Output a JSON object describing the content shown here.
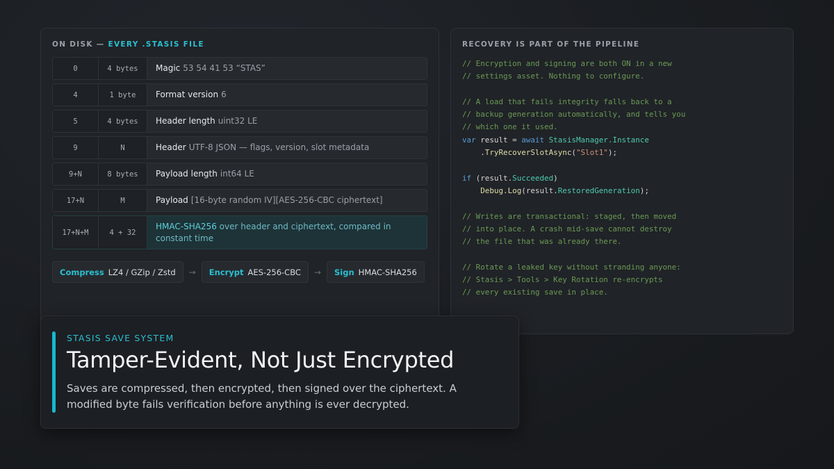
{
  "disk": {
    "title_prefix": "ON DISK —",
    "title_accent": "EVERY .STASIS FILE",
    "rows": [
      {
        "offset": "0",
        "size": "4 bytes",
        "name": "Magic",
        "detail": "53 54 41 53  “STAS”"
      },
      {
        "offset": "4",
        "size": "1 byte",
        "name": "Format version",
        "detail": "6"
      },
      {
        "offset": "5",
        "size": "4 bytes",
        "name": "Header length",
        "detail": "uint32 LE"
      },
      {
        "offset": "9",
        "size": "N",
        "name": "Header",
        "detail": "UTF-8 JSON — flags, version, slot metadata"
      },
      {
        "offset": "9+N",
        "size": "8 bytes",
        "name": "Payload length",
        "detail": "int64 LE"
      },
      {
        "offset": "17+N",
        "size": "M",
        "name": "Payload",
        "detail": "[16-byte random IV][AES-256-CBC ciphertext]"
      },
      {
        "offset": "17+N+M",
        "size": "4 + 32",
        "name": "HMAC-SHA256",
        "detail": "over header and ciphertext, compared in constant time"
      }
    ],
    "pipeline": [
      {
        "key": "Compress",
        "value": "LZ4 / GZip / Zstd"
      },
      {
        "key": "Encrypt",
        "value": "AES-256-CBC"
      },
      {
        "key": "Sign",
        "value": "HMAC-SHA256"
      }
    ],
    "arrow": "→"
  },
  "recovery": {
    "title": "RECOVERY IS PART OF THE PIPELINE",
    "code": {
      "c1": "// Encryption and signing are both ON in a new",
      "c2": "// settings asset. Nothing to configure.",
      "c3": "// A load that fails integrity falls back to a",
      "c4": "// backup generation automatically, and tells you",
      "c5": "// which one it used.",
      "var": "var",
      "result_assign": " result = ",
      "await": "await",
      "manager": "StasisManager",
      "instance": ".Instance",
      "recover_fn": "TryRecoverSlotAsync",
      "slot": "\"Slot1\"",
      "if": "if",
      "result_open": " (result.",
      "succeeded": "Succeeded",
      "debug": "Debug",
      "log": "Log",
      "restored": "RestoredGeneration",
      "c6": "// Writes are transactional: staged, then moved",
      "c7": "// into place. A crash mid-save cannot destroy",
      "c8": "// the file that was already there.",
      "c9": "// Rotate a leaked key without stranding anyone:",
      "c10": "// Stasis > Tools > Key Rotation re-encrypts",
      "c11": "// every existing save in place."
    }
  },
  "hero": {
    "kicker": "STASIS SAVE SYSTEM",
    "title": "Tamper-Evident, Not Just Encrypted",
    "body": "Saves are compressed, then encrypted, then signed over the ciphertext. A modified byte fails verification before anything is ever decrypted."
  },
  "colors": {
    "accent": "#2bbfd1",
    "background": "#1b1e22"
  }
}
